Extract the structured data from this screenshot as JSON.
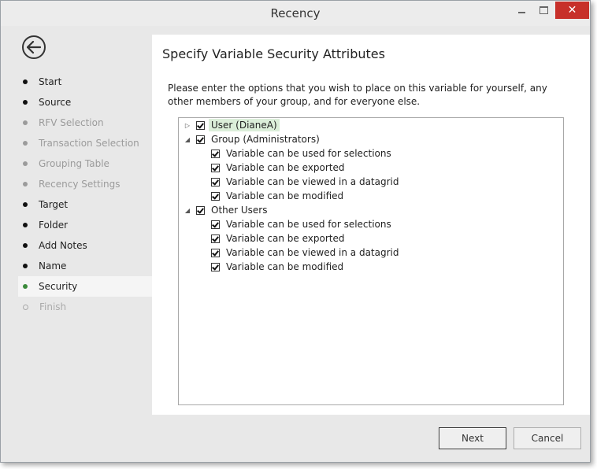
{
  "window": {
    "title": "Recency",
    "close_glyph": "✕"
  },
  "sidebar": {
    "back_icon": "arrow-left-icon",
    "steps": [
      {
        "label": "Start",
        "state": "done"
      },
      {
        "label": "Source",
        "state": "done"
      },
      {
        "label": "RFV Selection",
        "state": "disabled"
      },
      {
        "label": "Transaction Selection",
        "state": "disabled"
      },
      {
        "label": "Grouping Table",
        "state": "disabled"
      },
      {
        "label": "Recency Settings",
        "state": "disabled"
      },
      {
        "label": "Target",
        "state": "done"
      },
      {
        "label": "Folder",
        "state": "done"
      },
      {
        "label": "Add Notes",
        "state": "done"
      },
      {
        "label": "Name",
        "state": "done"
      },
      {
        "label": "Security",
        "state": "active"
      },
      {
        "label": "Finish",
        "state": "future"
      }
    ]
  },
  "main": {
    "heading": "Specify Variable Security Attributes",
    "description": "Please enter the options that you wish to place on this variable for yourself, any other members of your group, and for everyone else.",
    "tree": {
      "user": {
        "label": "User (DianeA)",
        "checked": true,
        "expanded": false
      },
      "group": {
        "label": "Group (Administrators)",
        "checked": true,
        "expanded": true,
        "children": [
          {
            "label": "Variable can be used for selections",
            "checked": true
          },
          {
            "label": "Variable can be exported",
            "checked": true
          },
          {
            "label": "Variable can be viewed in a datagrid",
            "checked": true
          },
          {
            "label": "Variable can be modified",
            "checked": true
          }
        ]
      },
      "others": {
        "label": "Other Users",
        "checked": true,
        "expanded": true,
        "children": [
          {
            "label": "Variable can be used for selections",
            "checked": true
          },
          {
            "label": "Variable can be exported",
            "checked": true
          },
          {
            "label": "Variable can be viewed in a datagrid",
            "checked": true
          },
          {
            "label": "Variable can be modified",
            "checked": true
          }
        ]
      }
    }
  },
  "footer": {
    "next_label": "Next",
    "cancel_label": "Cancel"
  },
  "colors": {
    "close_button": "#c7302a",
    "active_step_dot": "#3a8a3a",
    "selected_node": "#dbeed9"
  }
}
